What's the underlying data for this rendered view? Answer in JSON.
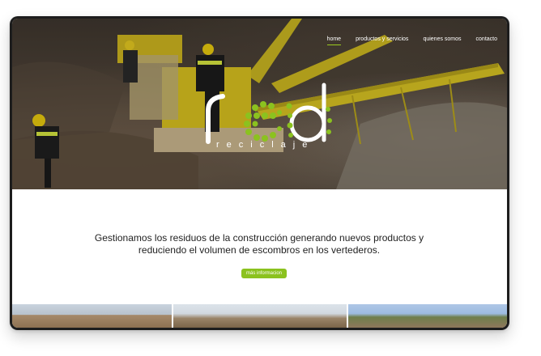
{
  "nav": {
    "items": [
      {
        "label": "home",
        "active": true
      },
      {
        "label": "productos y servicios",
        "active": false
      },
      {
        "label": "quienes somos",
        "active": false
      },
      {
        "label": "contacto",
        "active": false
      }
    ]
  },
  "logo": {
    "main": "red",
    "sub": "reciclaje",
    "accent_color": "#8bc21f"
  },
  "hero": {
    "image": "construction-site-conveyor"
  },
  "main": {
    "tagline": "Gestionamos los residuos de la construcción generando nuevos productos y reduciendo el volumen de escombros en los vertederos.",
    "button_label": "más informacion"
  },
  "gallery": {
    "images": [
      "sand-pile-photo",
      "gravel-pile-photo",
      "rubble-site-photo"
    ]
  }
}
